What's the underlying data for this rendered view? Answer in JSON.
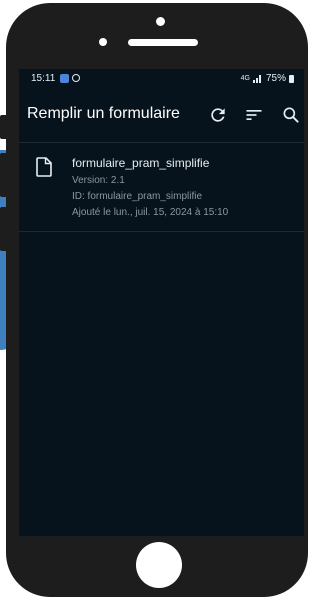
{
  "status_bar": {
    "time": "15:11",
    "network": "4G",
    "battery": "75%"
  },
  "app_bar": {
    "title": "Remplir un formulaire",
    "actions": [
      "refresh-icon",
      "sort-icon",
      "search-icon"
    ]
  },
  "forms": [
    {
      "name": "formulaire_pram_simplifie",
      "version": "Version: 2.1",
      "id": "ID: formulaire_pram_simplifie",
      "added": "Ajouté le lun., juil. 15, 2024 à 15:10"
    }
  ],
  "colors": {
    "screen_bg": "#06131c",
    "phone_body": "#1d1d1d",
    "accent_blue": "#3e7fc0"
  }
}
